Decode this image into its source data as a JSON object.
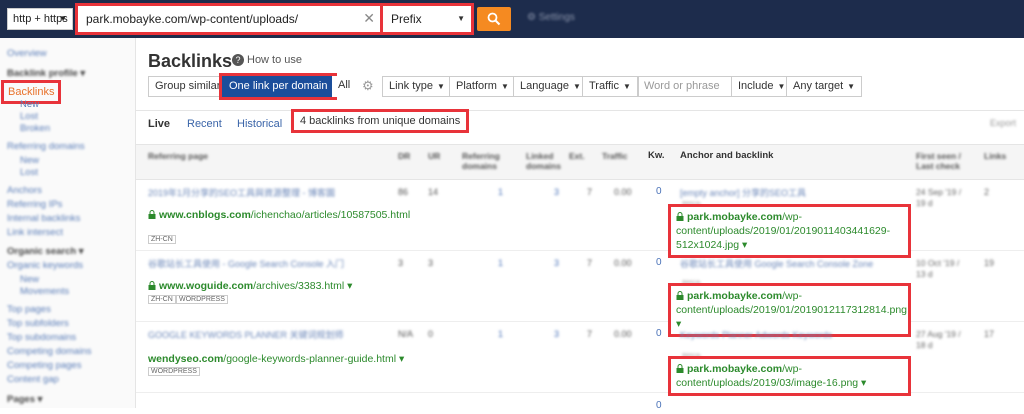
{
  "topbar": {
    "protocol": "http + https",
    "url_value": "park.mobayke.com/wp-content/uploads/",
    "mode": "Prefix",
    "settings": "Settings"
  },
  "sidebar": {
    "items": [
      {
        "label": "Overview"
      },
      {
        "label": "Backlink profile ▾"
      },
      {
        "label": "Backlinks"
      },
      {
        "label": "New"
      },
      {
        "label": "Lost"
      },
      {
        "label": "Broken"
      },
      {
        "label": "Referring domains"
      },
      {
        "label": "New"
      },
      {
        "label": "Lost"
      },
      {
        "label": "Anchors"
      },
      {
        "label": "Referring IPs"
      },
      {
        "label": "Internal backlinks"
      },
      {
        "label": "Link intersect"
      },
      {
        "label": "Organic search ▾"
      },
      {
        "label": "Organic keywords"
      },
      {
        "label": "New"
      },
      {
        "label": "Movements"
      },
      {
        "label": "Top pages"
      },
      {
        "label": "Top subfolders"
      },
      {
        "label": "Top subdomains"
      },
      {
        "label": "Competing domains"
      },
      {
        "label": "Competing pages"
      },
      {
        "label": "Content gap"
      },
      {
        "label": "Pages ▾"
      }
    ]
  },
  "main": {
    "title": "Backlinks",
    "howto": "How to use",
    "filters": {
      "group_similar": "Group similar",
      "one_link": "One link per domain",
      "all": "All",
      "link_type": "Link type",
      "platform": "Platform",
      "language": "Language",
      "traffic": "Traffic",
      "phrase_placeholder": "Word or phrase",
      "include": "Include",
      "any_target": "Any target"
    },
    "tabs": {
      "live": "Live",
      "recent": "Recent",
      "historical": "Historical"
    },
    "count": "4 backlinks from unique domains",
    "export": "Export"
  },
  "table": {
    "headers": {
      "referring_page": "Referring page",
      "dr": "DR",
      "ur": "UR",
      "ref_domains": "Referring domains",
      "linked_domains": "Linked domains",
      "ext": "Ext.",
      "traffic": "Traffic",
      "kw": "Kw.",
      "anchor": "Anchor and backlink",
      "first_seen": "First seen / Last check",
      "links": "Links"
    },
    "rows": [
      {
        "title": "2019年1月分享的SEO工具與資源整理 - 博客園",
        "url_domain": "www.cnblogs.com",
        "url_path": "/ichenchao/articles/10587505.html",
        "tags": [
          "ZH-CN"
        ],
        "dr": "86",
        "ur": "14",
        "rd": "1",
        "ld": "3",
        "ext": "7",
        "traffic": "0.00",
        "kw": "0",
        "anchor_text": "[empty anchor] 分享的SEO工具",
        "image": "IMAGE",
        "bl_domain": "park.mobayke.com",
        "bl_path": "/wp-content/uploads/2019/01/2019011403441629-512x1024.jpg",
        "date": "24 Sep '19 / 19 d",
        "links": "2"
      },
      {
        "title": "谷歌站长工具使用 - Google Search Console 入门",
        "url_domain": "www.woguide.com",
        "url_path": "/archives/3383.html",
        "tags": [
          "ZH-CN",
          "WORDPRESS"
        ],
        "dr": "3",
        "ur": "3",
        "rd": "1",
        "ld": "3",
        "ext": "7",
        "traffic": "0.00",
        "kw": "0",
        "anchor_text": "谷歌站长工具使用 Google Search Console Zone",
        "image": "IMAGE",
        "bl_domain": "park.mobayke.com",
        "bl_path": "/wp-content/uploads/2019/01/2019012117312814.png",
        "date": "10 Oct '19 / 13 d",
        "links": "19"
      },
      {
        "title": "GOOGLE KEYWORDS PLANNER 关键词规划师",
        "url_domain": "wendyseo.com",
        "url_path": "/google-keywords-planner-guide.html",
        "tags": [
          "WORDPRESS"
        ],
        "dr": "N/A",
        "ur": "0",
        "rd": "1",
        "ld": "3",
        "ext": "7",
        "traffic": "0.00",
        "kw": "0",
        "anchor_text": "Keywords Planner Adwords Keywords",
        "image": "IMAGE",
        "bl_domain": "park.mobayke.com",
        "bl_path": "/wp-content/uploads/2019/03/image-16.png",
        "date": "27 Aug '19 / 18 d",
        "links": "17"
      }
    ]
  },
  "colors": {
    "accent": "#1b4e9b",
    "highlight": "#e8333a",
    "link_green": "#2c8a2c",
    "search": "#f58a21"
  }
}
